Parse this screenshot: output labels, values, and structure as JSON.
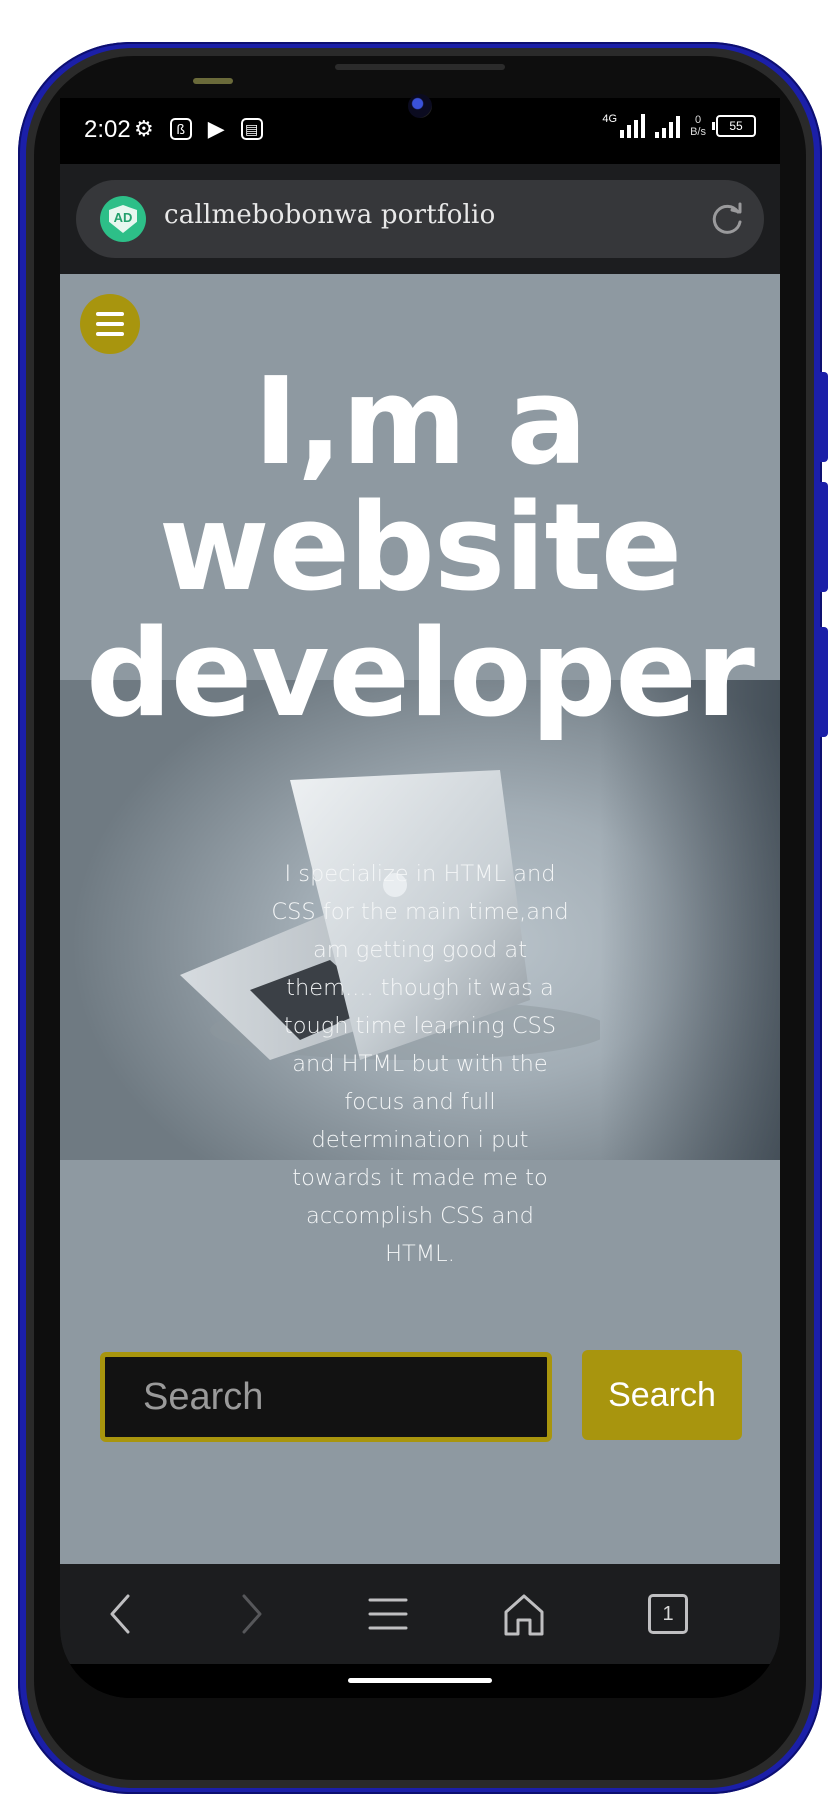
{
  "status_bar": {
    "time": "2:02",
    "network_type": "4G",
    "net_speed_value": "0",
    "net_speed_unit": "B/s",
    "battery_level": "55"
  },
  "browser": {
    "shield_badge": "AD",
    "site_title": "callmebobonwa portfolio"
  },
  "page": {
    "headline_lines": [
      "I,m a",
      "website",
      "developer"
    ],
    "intro": "I specialize in HTML and CSS for the main time,and am getting good at them.... though it was a tough time learning CSS and HTML but with the focus and full determination i put towards it made me to accomplish CSS and HTML.",
    "search": {
      "placeholder": "Search",
      "button_label": "Search"
    }
  },
  "nav": {
    "tab_count": "1"
  },
  "colors": {
    "accent": "#a8950e",
    "page_background": "#8e99a1",
    "browser_chrome": "#1c1d1f",
    "shield": "#2dbf88"
  }
}
